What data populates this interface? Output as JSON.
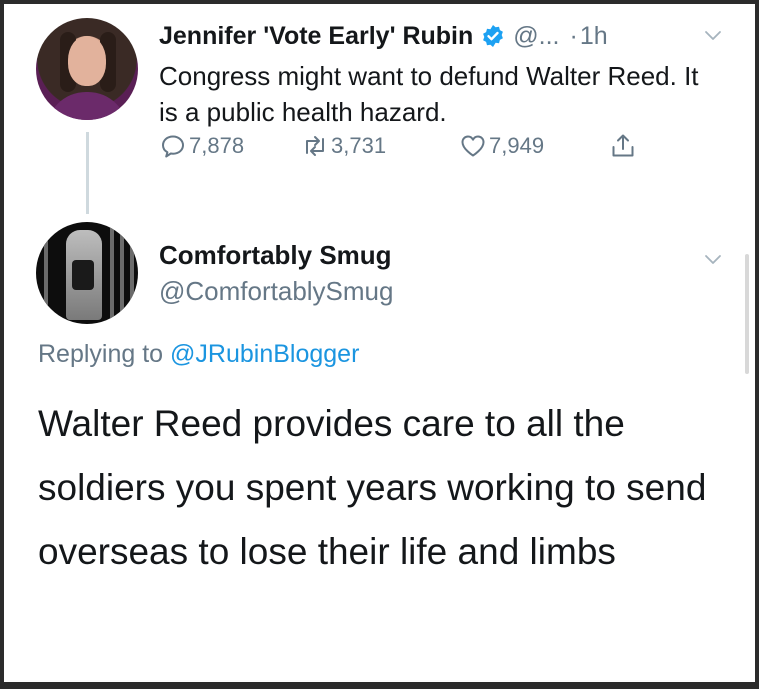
{
  "tweet1": {
    "name": "Jennifer 'Vote Early' Rubin",
    "handle": "@...",
    "dot": "·",
    "time": "1h",
    "text": "Congress might want to defund Walter Reed. It is a public health hazard.",
    "replies": "7,878",
    "retweets": "3,731",
    "likes": "7,949"
  },
  "tweet2": {
    "name": "Comfortably Smug",
    "handle": "@ComfortablySmug",
    "replying_prefix": "Replying to ",
    "replying_to": "@JRubinBlogger",
    "text": "Walter Reed provides care to all the soldiers you spent years working to send overseas to lose their life and limbs"
  },
  "icons": {
    "verified": "verified-badge-icon",
    "chevron": "chevron-down-icon",
    "reply": "reply-icon",
    "retweet": "retweet-icon",
    "like": "heart-icon",
    "share": "share-icon"
  },
  "colors": {
    "text": "#14171a",
    "secondary": "#657786",
    "link": "#1b95e0",
    "verified": "#1da1f2"
  }
}
